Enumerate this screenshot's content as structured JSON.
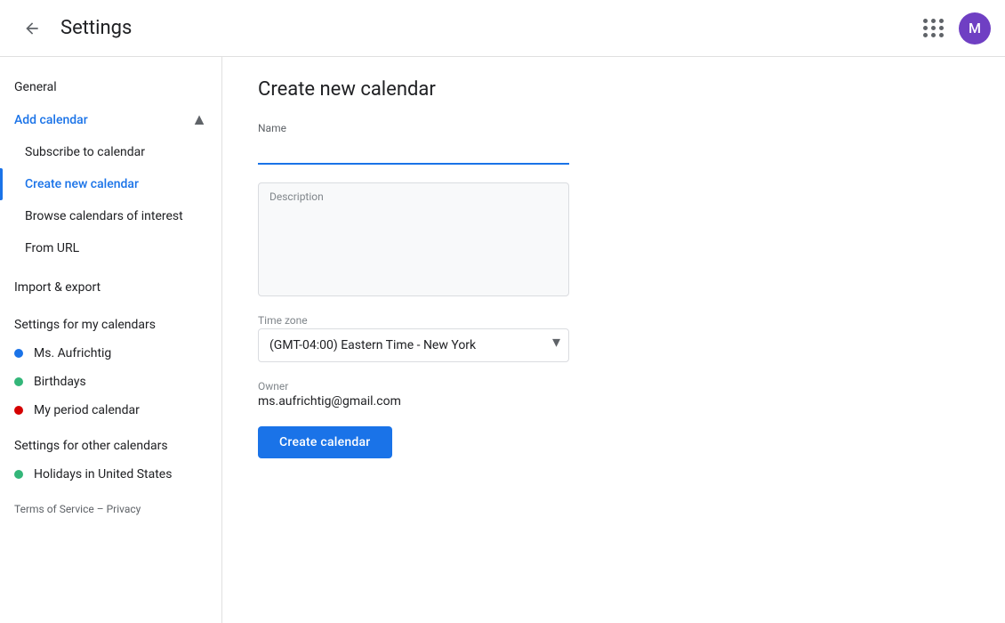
{
  "topbar": {
    "back_label": "←",
    "title": "Settings",
    "avatar_letter": "M"
  },
  "sidebar": {
    "general_label": "General",
    "add_calendar_label": "Add calendar",
    "add_calendar_items": [
      {
        "id": "subscribe",
        "label": "Subscribe to calendar",
        "active": false
      },
      {
        "id": "create",
        "label": "Create new calendar",
        "active": true
      },
      {
        "id": "browse",
        "label": "Browse calendars of interest",
        "active": false
      },
      {
        "id": "url",
        "label": "From URL",
        "active": false
      }
    ],
    "import_export_label": "Import & export",
    "settings_my_calendars_label": "Settings for my calendars",
    "my_calendars": [
      {
        "id": "ms",
        "label": "Ms. Aufrichtig",
        "color": "#1a73e8"
      },
      {
        "id": "birthdays",
        "label": "Birthdays",
        "color": "#33b679"
      },
      {
        "id": "period",
        "label": "My period calendar",
        "color": "#d50000"
      }
    ],
    "settings_other_calendars_label": "Settings for other calendars",
    "other_calendars": [
      {
        "id": "holidays",
        "label": "Holidays in United States",
        "color": "#33b679"
      }
    ],
    "footer": {
      "terms": "Terms of Service",
      "separator": " – ",
      "privacy": "Privacy"
    }
  },
  "main": {
    "page_title": "Create new calendar",
    "name_label": "Name",
    "name_placeholder": "",
    "description_label": "Description",
    "timezone_label": "Time zone",
    "timezone_value": "(GMT-04:00) Eastern Time - New York",
    "owner_label": "Owner",
    "owner_value": "ms.aufrichtig@gmail.com",
    "create_button_label": "Create calendar"
  }
}
